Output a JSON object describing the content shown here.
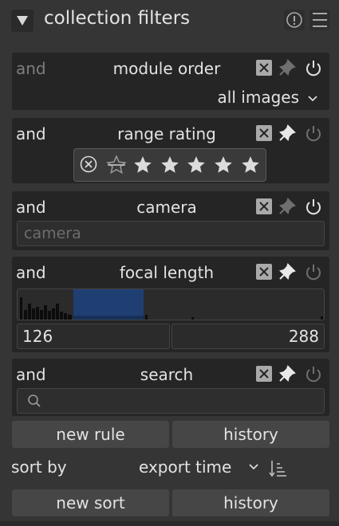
{
  "header": {
    "title": "collection filters",
    "icons": [
      "collapse-triangle-icon",
      "info-icon",
      "presets-menu-icon"
    ]
  },
  "rules": [
    {
      "operator": "and",
      "title": "module order",
      "value": "all images"
    },
    {
      "operator": "and",
      "title": "range rating"
    },
    {
      "operator": "and",
      "title": "camera",
      "placeholder": "camera"
    },
    {
      "operator": "and",
      "title": "focal length",
      "min": "126",
      "max": "288"
    },
    {
      "operator": "and",
      "title": "search"
    }
  ],
  "buttons": {
    "new_rule": "new rule",
    "history": "history",
    "new_sort": "new sort"
  },
  "sort": {
    "label": "sort by",
    "value": "export time"
  },
  "colors": {
    "panel_bg": "#353535",
    "rule_bg": "#252525",
    "button_bg": "#464646",
    "histogram_selection": "#1f3f73"
  }
}
